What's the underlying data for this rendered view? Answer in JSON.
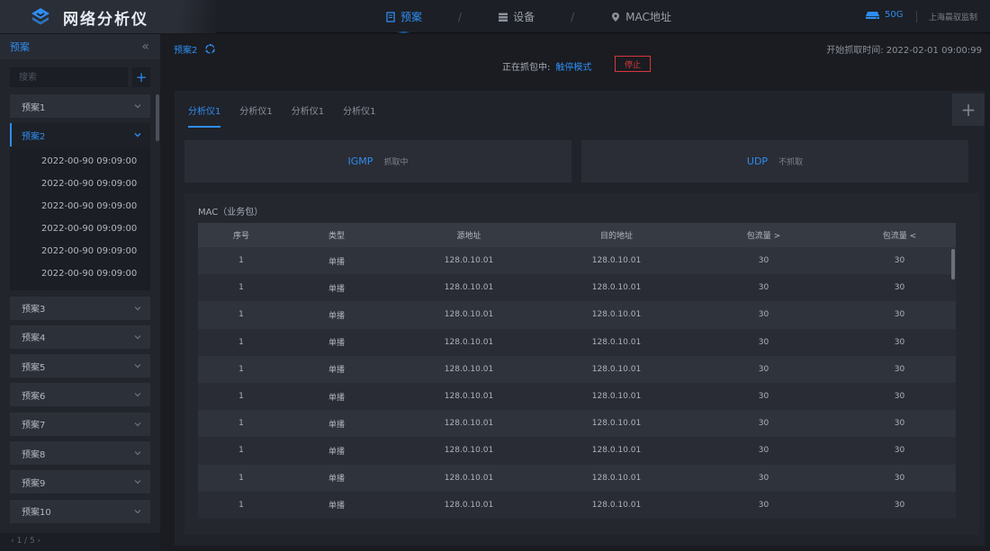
{
  "app": {
    "title": "网络分析仪"
  },
  "nav": {
    "items": [
      {
        "label": "预案",
        "icon": "file-icon",
        "active": true
      },
      {
        "label": "设备",
        "icon": "server-icon",
        "active": false
      },
      {
        "label": "MAC地址",
        "icon": "location-pin-icon",
        "active": false
      }
    ],
    "separator": "/"
  },
  "header": {
    "storage": "50G",
    "storage_icon": "disk-icon",
    "org": "上海晨驭监制"
  },
  "sidebar": {
    "title": "预案",
    "collapse_glyph": "«",
    "search_placeholder": "搜索",
    "add_glyph": "+",
    "items": [
      {
        "label": "预案1"
      },
      {
        "label": "预案2",
        "open": true,
        "children": [
          "2022-00-90  09:09:00",
          "2022-00-90  09:09:00",
          "2022-00-90  09:09:00",
          "2022-00-90  09:09:00",
          "2022-00-90  09:09:00",
          "2022-00-90  09:09:00"
        ]
      },
      {
        "label": "预案3"
      },
      {
        "label": "预案4"
      },
      {
        "label": "预案5"
      },
      {
        "label": "预案6"
      },
      {
        "label": "预案7"
      },
      {
        "label": "预案8"
      },
      {
        "label": "预案9"
      },
      {
        "label": "预案10"
      }
    ],
    "pager": "‹  1  /  5  ›"
  },
  "main": {
    "breadcrumb": "预案2",
    "capture_label": "正在抓包中:",
    "capture_mode": "触停模式",
    "stop_label": "停止",
    "start_time": "开始抓取时间:  2022-02-01  09:00:99",
    "tabs": [
      "分析仪1",
      "分析仪1",
      "分析仪1",
      "分析仪1"
    ],
    "tab_add_glyph": "+",
    "protocols": [
      {
        "name": "IGMP",
        "state": "抓取中"
      },
      {
        "name": "UDP",
        "state": "不抓取"
      }
    ],
    "table": {
      "title": "MAC（业务包）",
      "headers": [
        "序号",
        "类型",
        "源地址",
        "目的地址",
        "包流量 >",
        "包流量 <"
      ],
      "rows": [
        [
          "1",
          "单播",
          "128.0.10.01",
          "128.0.10.01",
          "30",
          "30"
        ],
        [
          "1",
          "单播",
          "128.0.10.01",
          "128.0.10.01",
          "30",
          "30"
        ],
        [
          "1",
          "单播",
          "128.0.10.01",
          "128.0.10.01",
          "30",
          "30"
        ],
        [
          "1",
          "单播",
          "128.0.10.01",
          "128.0.10.01",
          "30",
          "30"
        ],
        [
          "1",
          "单播",
          "128.0.10.01",
          "128.0.10.01",
          "30",
          "30"
        ],
        [
          "1",
          "单播",
          "128.0.10.01",
          "128.0.10.01",
          "30",
          "30"
        ],
        [
          "1",
          "单播",
          "128.0.10.01",
          "128.0.10.01",
          "30",
          "30"
        ],
        [
          "1",
          "单播",
          "128.0.10.01",
          "128.0.10.01",
          "30",
          "30"
        ],
        [
          "1",
          "单播",
          "128.0.10.01",
          "128.0.10.01",
          "30",
          "30"
        ],
        [
          "1",
          "单播",
          "128.0.10.01",
          "128.0.10.01",
          "30",
          "30"
        ]
      ]
    }
  },
  "colors": {
    "accent": "#2e8df2",
    "danger": "#d9363e",
    "bg": "#16181d",
    "panel": "#20232a"
  }
}
